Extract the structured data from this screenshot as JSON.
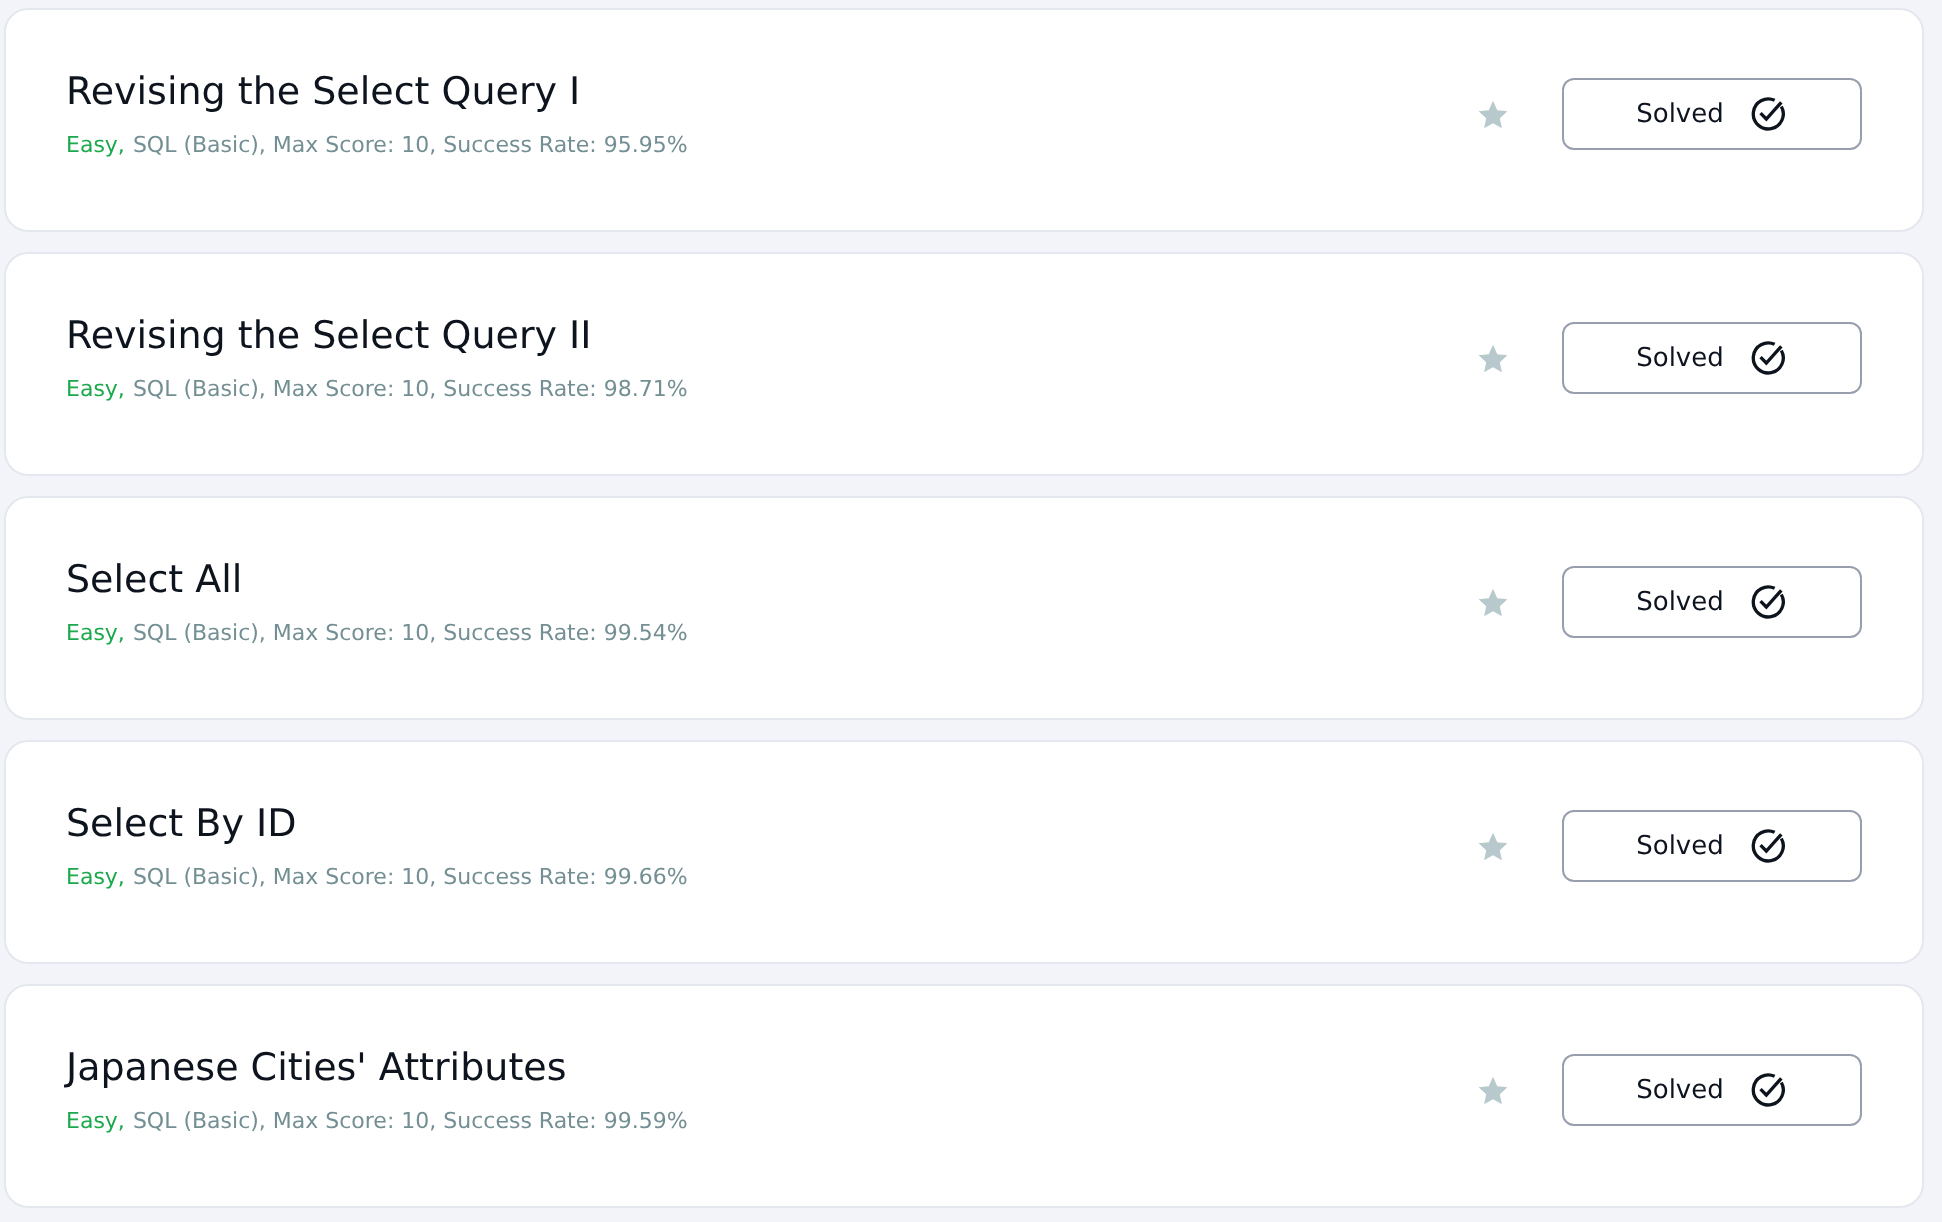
{
  "challenges": [
    {
      "title": "Revising the Select Query I",
      "difficulty": "Easy,",
      "details": "SQL (Basic), Max Score: 10, Success Rate: 95.95%",
      "bookmarked": false,
      "button": "Solved"
    },
    {
      "title": "Revising the Select Query II",
      "difficulty": "Easy,",
      "details": "SQL (Basic), Max Score: 10, Success Rate: 98.71%",
      "bookmarked": false,
      "button": "Solved"
    },
    {
      "title": "Select All",
      "difficulty": "Easy,",
      "details": "SQL (Basic), Max Score: 10, Success Rate: 99.54%",
      "bookmarked": false,
      "button": "Solved"
    },
    {
      "title": "Select By ID",
      "difficulty": "Easy,",
      "details": "SQL (Basic), Max Score: 10, Success Rate: 99.66%",
      "bookmarked": false,
      "button": "Solved"
    },
    {
      "title": "Japanese Cities' Attributes",
      "difficulty": "Easy,",
      "details": "SQL (Basic), Max Score: 10, Success Rate: 99.59%",
      "bookmarked": false,
      "button": "Solved"
    }
  ]
}
